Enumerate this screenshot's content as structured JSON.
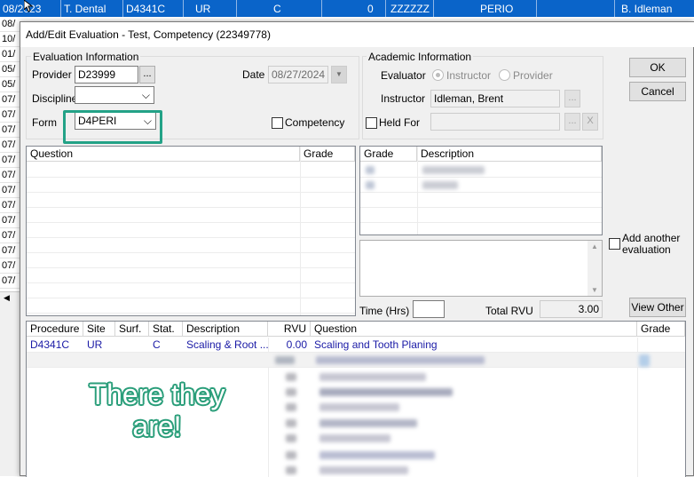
{
  "background_grid": {
    "top_row": {
      "date": "08/2023",
      "provider": "T. Dental",
      "procedure": "D4341C",
      "site": "UR",
      "status": "C",
      "count": "0",
      "code": "ZZZZZZ",
      "discipline": "PERIO",
      "instructor": "B. Idleman"
    },
    "left_dates": [
      "08/",
      "10/",
      "01/",
      "05/",
      "05/",
      "07/",
      "07/",
      "07/",
      "07/",
      "07/",
      "07/",
      "07/",
      "07/",
      "07/",
      "07/",
      "07/",
      "07/",
      "07/"
    ]
  },
  "dialog": {
    "title": "Add/Edit Evaluation - Test, Competency (22349778)",
    "eval_info": {
      "legend": "Evaluation Information",
      "provider_label": "Provider",
      "provider_value": "D23999",
      "browse": "...",
      "date_label": "Date",
      "date_value": "08/27/2024",
      "discipline_label": "Discipline",
      "discipline_value": "",
      "form_label": "Form",
      "form_value": "D4PERI",
      "competency_label": "Competency"
    },
    "academic_info": {
      "legend": "Academic Information",
      "evaluator_label": "Evaluator",
      "radio_instructor": "Instructor",
      "radio_provider": "Provider",
      "instructor_label": "Instructor",
      "instructor_value": "Idleman, Brent",
      "held_for_label": "Held For",
      "browse": "...",
      "clear": "X"
    },
    "buttons": {
      "ok": "OK",
      "cancel": "Cancel",
      "view_other": "View Other"
    },
    "add_another_label": "Add another evaluation",
    "question_grid": {
      "headers": [
        "Question",
        "Grade"
      ]
    },
    "grade_grid": {
      "headers": [
        "Grade",
        "Description"
      ]
    },
    "time_label": "Time (Hrs)",
    "time_value": "",
    "total_rvu_label": "Total RVU",
    "total_rvu_value": "3.00",
    "procedure_grid": {
      "headers": [
        "Procedure",
        "Site",
        "Surf.",
        "Stat.",
        "Description",
        "RVU",
        "Question",
        "Grade"
      ],
      "row": {
        "procedure": "D4341C",
        "site": "UR",
        "surf": "",
        "stat": "C",
        "description": "Scaling & Root ...",
        "rvu": "0.00",
        "question": "Scaling and Tooth Planing",
        "grade": ""
      }
    }
  },
  "annotation": {
    "text": "There they are!",
    "color": "#2a9e7a"
  },
  "colors": {
    "selection_blue": "#0a64c9",
    "highlight_green": "#23a287"
  }
}
